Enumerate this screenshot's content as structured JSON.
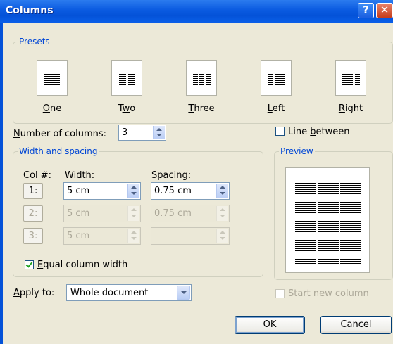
{
  "window": {
    "title": "Columns",
    "help_label": "?",
    "close_label": "✕"
  },
  "presets": {
    "legend": "Presets",
    "items": [
      {
        "label": "One",
        "key": "O",
        "rest": "ne"
      },
      {
        "label": "Two",
        "key": "w",
        "pre": "T",
        "rest": "o"
      },
      {
        "label": "Three",
        "key": "T",
        "rest": "hree"
      },
      {
        "label": "Left",
        "key": "L",
        "rest": "eft"
      },
      {
        "label": "Right",
        "key": "R",
        "rest": "ight"
      }
    ]
  },
  "number_of_columns": {
    "label_key": "N",
    "label_rest": "umber of columns:",
    "value": "3"
  },
  "line_between": {
    "label_pre": "Line ",
    "label_key": "b",
    "label_rest": "etween",
    "checked": false
  },
  "width_spacing": {
    "legend": "Width and spacing",
    "col_header_key": "C",
    "col_header_rest": "ol #:",
    "width_header_pre": "W",
    "width_header_key": "i",
    "width_header_rest": "dth:",
    "spacing_header_key": "S",
    "spacing_header_rest": "pacing:",
    "rows": [
      {
        "col": "1:",
        "width": "5 cm",
        "spacing": "0.75 cm",
        "enabled": true
      },
      {
        "col": "2:",
        "width": "5 cm",
        "spacing": "0.75 cm",
        "enabled": false
      },
      {
        "col": "3:",
        "width": "5 cm",
        "spacing": "",
        "enabled": false
      }
    ],
    "equal_width": {
      "label_key": "E",
      "label_rest": "qual column width",
      "checked": true
    }
  },
  "preview": {
    "legend": "Preview"
  },
  "apply_to": {
    "label_key": "A",
    "label_rest": "pply to:",
    "value": "Whole document"
  },
  "start_new_column": {
    "label": "Start new column",
    "checked": false,
    "enabled": false
  },
  "buttons": {
    "ok": "OK",
    "cancel": "Cancel"
  }
}
